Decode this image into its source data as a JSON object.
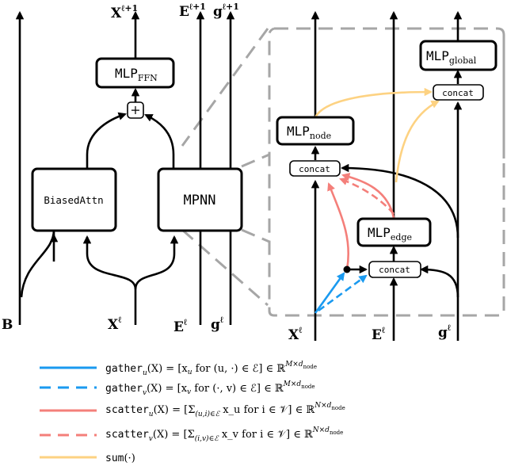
{
  "diagram": {
    "left": {
      "boxes": {
        "mlp_ffn": {
          "name": "MLP",
          "sub": "FFN"
        },
        "biased_attn": "BiasedAttn",
        "mpnn": "MPNN",
        "add_symbol": "+"
      },
      "outputs": {
        "x_next": {
          "base": "X",
          "sup": "ℓ+1"
        },
        "e_next": {
          "base": "E",
          "sup": "ℓ+1"
        },
        "g_next": {
          "base": "g",
          "sup": "ℓ+1"
        }
      },
      "inputs": {
        "b": "B",
        "x": {
          "base": "X",
          "sup": "ℓ"
        },
        "e": {
          "base": "E",
          "sup": "ℓ"
        },
        "g": {
          "base": "g",
          "sup": "ℓ"
        }
      }
    },
    "right": {
      "boxes": {
        "mlp_node": {
          "name": "MLP",
          "sub": "node"
        },
        "mlp_edge": {
          "name": "MLP",
          "sub": "edge"
        },
        "mlp_global": {
          "name": "MLP",
          "sub": "global"
        },
        "concat_node": "concat",
        "concat_edge": "concat",
        "concat_global": "concat"
      },
      "inputs": {
        "x": {
          "base": "X",
          "sup": "ℓ"
        },
        "e": {
          "base": "E",
          "sup": "ℓ"
        },
        "g": {
          "base": "g",
          "sup": "ℓ"
        }
      }
    }
  },
  "colors": {
    "gather": "#1a9af0",
    "scatter": "#f47f7a",
    "sum": "#fdd282",
    "zoom_frame": "#a6a6a6",
    "stroke": "#000000"
  },
  "legend": [
    {
      "style": "solid",
      "color_key": "gather",
      "fn": "gather",
      "sub": "u",
      "rest": "(X) = [x",
      "rest_sub": "u",
      "tail": " for (u, ·) ∈ ℰ] ∈ ℝ",
      "sup": "M×d",
      "sup_sub": "node"
    },
    {
      "style": "dashed",
      "color_key": "gather",
      "fn": "gather",
      "sub": "v",
      "rest": "(X) = [x",
      "rest_sub": "v",
      "tail": " for (·, v) ∈ ℰ] ∈ ℝ",
      "sup": "M×d",
      "sup_sub": "node"
    },
    {
      "style": "solid",
      "color_key": "scatter",
      "fn": "scatter",
      "sub": "u",
      "rest": "(X) = [Σ",
      "rest_sub": "(u,i)∈ℰ",
      "tail": " x_u for i ∈ 𝒱] ∈ ℝ",
      "sup": "N×d",
      "sup_sub": "node"
    },
    {
      "style": "dashed",
      "color_key": "scatter",
      "fn": "scatter",
      "sub": "v",
      "rest": "(X) = [Σ",
      "rest_sub": "(i,v)∈ℰ",
      "tail": " x_v for i ∈ 𝒱] ∈ ℝ",
      "sup": "N×d",
      "sup_sub": "node"
    },
    {
      "style": "solid",
      "color_key": "sum",
      "fn": "sum",
      "sub": "",
      "rest": "(·)",
      "rest_sub": "",
      "tail": "",
      "sup": "",
      "sup_sub": ""
    }
  ]
}
